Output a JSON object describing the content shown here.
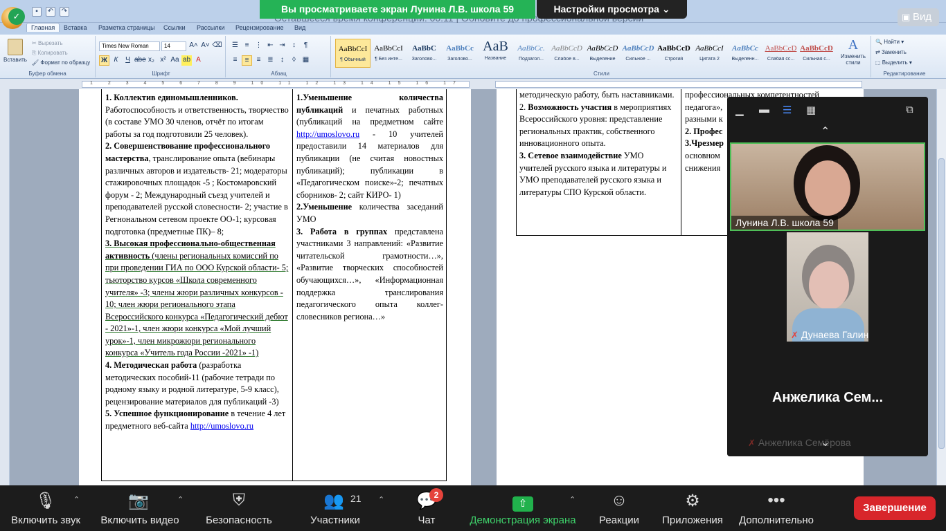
{
  "zoom": {
    "share_banner": "Вы просматриваете экран Лунина Л.В. школа 59",
    "view_settings": "Настройки просмотра",
    "view_button": "Вид",
    "participants": [
      {
        "name": "Лунина Л.В. школа 59"
      },
      {
        "name": "Дунаева Галина"
      },
      {
        "name": "Анжелика  Сем...",
        "full_name": "Анжелика Семёрова"
      }
    ],
    "toolbar": {
      "audio": "Включить звук",
      "video": "Включить видео",
      "security": "Безопасность",
      "participants": "Участники",
      "participants_count": "21",
      "chat": "Чат",
      "chat_badge": "2",
      "share": "Демонстрация экрана",
      "reactions": "Реакции",
      "apps": "Приложения",
      "more": "Дополнительно",
      "end": "Завершение"
    }
  },
  "word": {
    "title_overlay": "Оставшееся время конференции: 00:11 | Обновите до профессиональной версии",
    "tabs": [
      "Главная",
      "Вставка",
      "Разметка страницы",
      "Ссылки",
      "Рассылки",
      "Рецензирование",
      "Вид"
    ],
    "ribbon": {
      "paste": "Вставить",
      "cut": "Вырезать",
      "copy": "Копировать",
      "format_painter": "Формат по образцу",
      "group_clipboard": "Буфер обмена",
      "font_name": "Times New Roman",
      "font_size": "14",
      "group_font": "Шрифт",
      "group_paragraph": "Абзац",
      "group_styles": "Стили",
      "group_editing": "Редактирование",
      "find": "Найти",
      "replace": "Заменить",
      "select": "Выделить",
      "change_styles": "Изменить стили",
      "styles": [
        {
          "sample": "AaBbCcI",
          "name": "¶ Обычный"
        },
        {
          "sample": "AaBbCcI",
          "name": "¶ Без инте..."
        },
        {
          "sample": "AaBbC",
          "name": "Заголово..."
        },
        {
          "sample": "AaBbCc",
          "name": "Заголово..."
        },
        {
          "sample": "AaB",
          "name": "Название"
        },
        {
          "sample": "AaBbCc.",
          "name": "Подзагол..."
        },
        {
          "sample": "AaBbCcD",
          "name": "Слабое в..."
        },
        {
          "sample": "AaBbCcD",
          "name": "Выделение"
        },
        {
          "sample": "AaBbCcD",
          "name": "Сильное ..."
        },
        {
          "sample": "AaBbCcD",
          "name": "Строгий"
        },
        {
          "sample": "AaBbCcI",
          "name": "Цитата 2"
        },
        {
          "sample": "AaBbCc",
          "name": "Выделенн..."
        },
        {
          "sample": "AaBbCcD",
          "name": "Слабая сс..."
        },
        {
          "sample": "AaBbCcD",
          "name": "Сильная с..."
        }
      ]
    },
    "ruler_numbers": "1 2 3 4 5 6 7 8 9 10 11 12 13 14 15 16 17",
    "col1": {
      "p1_b": "1. Коллектив единомышленников.",
      "p1": " Работоспособность и ответственность, творчество (в составе УМО 30 членов,  отчёт по итогам работы за год подготовили  25 человек).",
      "p2_b": "2. Совершенствование профессионального мастерства",
      "p2": ", транслирование опыта (вебинары различных авторов и издательств- 21; модераторы стажировочных площадок -5 ; Костомаровский форум - 2; Международный съезд учителей и преподавателей русской словесности- 2; участие в Регнональном сетевом проекте ОО-1; курсовая подготовка (предметные ПК)– 8;",
      "p3_b": "3. Высокая профессионально-общественная активность",
      "p3": " (члены региональных  комиссий по при проведении ГИА по ООО Курской области- 5;  тьюторство курсов «Школа современного учителя» -3; члены жюри различных конкурсов - 10; член жюри регионального этапа Всероссийского конкурса «Педагогический дебют - 2021»-1, член жюри конкурса «Мой лучший урок»-1, член микрожюри регионального конкурса «Учитель года России -2021» -1)",
      "p4_b": "4. Методическая работа",
      "p4": " (разработка методических пособий-11 (рабочие тетради по родному языку и родной литературе, 5-9 класс), рецензирование материалов для публикаций -3)",
      "p5_b": "5. Успешное функционирование",
      "p5": " в течение 4 лет предметного веб-сайта  ",
      "link": "http://umoslovo.ru"
    },
    "col2": {
      "p1_b": "1.Уменьшение  количества публикаций",
      "p1a": "  и печатных работных (публикаций   на предметном сайте ",
      "link": "http://umoslovo.ru",
      "p1b": " - 10  учителей предоставили  14 материалов для публикации (не считая новостных публикаций);  публикации в «Педагогическом поиске»-2; печатных сборников- 2;  сайт КИРО- 1)",
      "p2_b": "2.Уменьшение",
      "p2": " количества заседаний УМО",
      "p3_b": "3. Работа в группах",
      "p3": " представлена участниками 3 направлений: «Развитие читательской грамотности…», «Развитие творческих способностей обучающихся…», «Информационная поддержка транслирования педагогического опыта коллег-словесников региона…»"
    },
    "col3": {
      "p0": "методическую работу, быть наставниками.",
      "p1_n": "2. ",
      "p1_b": "Возможность участия",
      "p1": "  в мероприятиях Всероссийского уровня: представление региональных практик, собственного инновационного опыта.",
      "p2_b": "3. Сетевое взаимодействие",
      "p2": " УМО учителей русского языка и литературы и УМО преподавателей русского языка и литературы СПО Курской области."
    },
    "col4": {
      "l1": "профессиональных      компетентностей",
      "l2": "педагога»,",
      "l3": "разными к",
      "l4_b": "2. Профес",
      "l5_b": "3.Чрезмер",
      "l6": "основном",
      "l7": "снижения"
    }
  }
}
